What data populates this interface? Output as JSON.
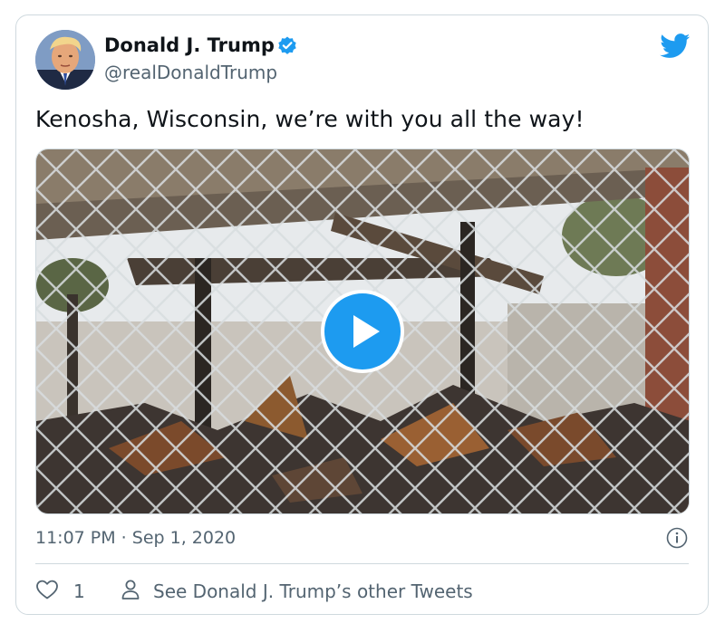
{
  "tweet": {
    "author_name": "Donald J. Trump",
    "handle": "@realDonaldTrump",
    "verified": true,
    "text": "Kenosha, Wisconsin, we’re with you all the way!",
    "timestamp": "11:07 PM · Sep 1, 2020",
    "like_count": "1",
    "other_tweets_label": "See Donald J. Trump’s other Tweets"
  },
  "media": {
    "type": "video",
    "play_icon": "play-icon"
  },
  "icons": {
    "brand": "twitter-bird-icon",
    "verified": "verified-badge-icon",
    "info": "info-icon",
    "like": "heart-icon",
    "profile": "person-icon"
  },
  "colors": {
    "accent": "#1d9bf0",
    "text": "#0f1419",
    "secondary_text": "#536471",
    "border": "#cfd9de"
  }
}
